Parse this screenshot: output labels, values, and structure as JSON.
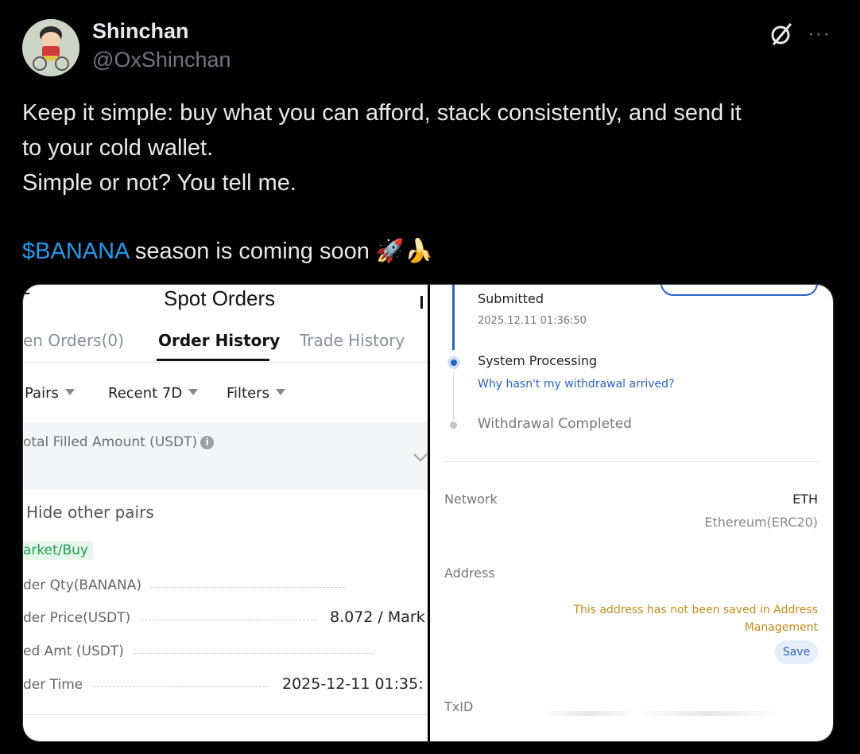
{
  "post": {
    "author_name": "Shinchan",
    "author_handle": "@OxShinchan",
    "text_lines": [
      "Keep it simple: buy what you can afford, stack consistently, and send it",
      "to your cold wallet.",
      "Simple or not? You tell me."
    ],
    "cashtag": "$BANANA",
    "last_line_rest": " season is coming soon 🚀🍌",
    "more_label": "···"
  },
  "left_screenshot": {
    "title": "Spot Orders",
    "tabs": [
      {
        "label": "en Orders(0)",
        "active": false
      },
      {
        "label": "Order History",
        "active": true
      },
      {
        "label": "Trade History",
        "active": false
      }
    ],
    "filters": [
      "Pairs",
      "Recent 7D",
      "Filters"
    ],
    "summary_label": "otal Filled Amount (USDT)",
    "info_glyph": "i",
    "hide_pairs": "Hide other pairs",
    "order_badge": "arket/Buy",
    "rows": [
      {
        "label": "der Qty(BANANA)",
        "value": ""
      },
      {
        "label": "der Price(USDT)",
        "value": "8.072 / Mark"
      },
      {
        "label": "ed Amt (USDT)",
        "value": ""
      },
      {
        "label": "der Time",
        "value": "2025-12-11 01:35:"
      }
    ]
  },
  "right_screenshot": {
    "steps": [
      {
        "label": "Submitted",
        "time": "2025.12.11 01:36:50"
      },
      {
        "label": "System Processing",
        "link": "Why hasn't my withdrawal arrived?"
      },
      {
        "label": "Withdrawal Completed"
      }
    ],
    "network_label": "Network",
    "network_value": "ETH",
    "network_sub": "Ethereum(ERC20)",
    "address_label": "Address",
    "address_warning": "This address has not been saved in Address Management",
    "save_label": "Save",
    "txid_label": "TxID"
  },
  "colors": {
    "background": "#000000",
    "cashtag": "#1d9bf0",
    "accent_blue": "#2a63c8",
    "warning": "#c98a1c",
    "success": "#1f9d55"
  }
}
